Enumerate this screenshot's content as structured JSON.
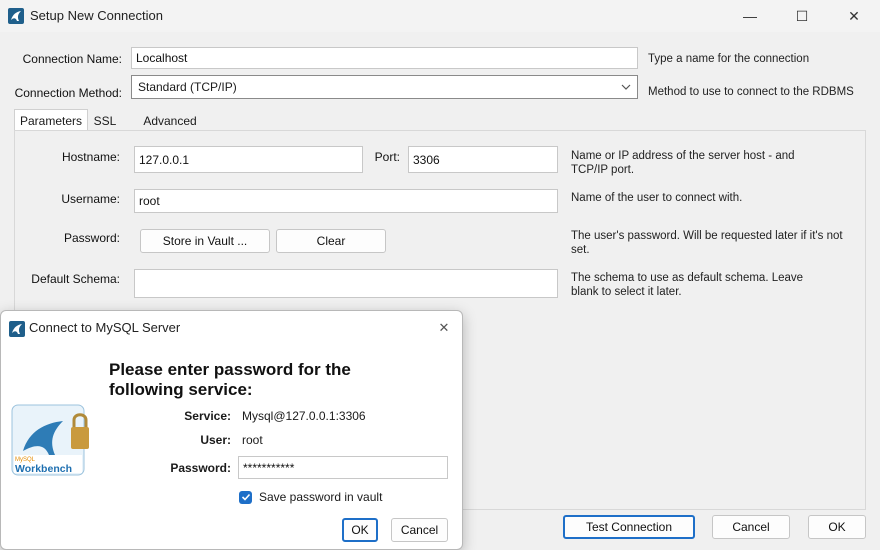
{
  "window": {
    "title": "Setup New Connection",
    "minimize_glyph": "—",
    "maximize_glyph": "☐",
    "close_glyph": "✕"
  },
  "form": {
    "connection_name_label": "Connection Name:",
    "connection_name_value": "Localhost",
    "connection_name_hint": "Type a name for the connection",
    "connection_method_label": "Connection Method:",
    "connection_method_value": "Standard (TCP/IP)",
    "connection_method_hint": "Method to use to connect to the RDBMS"
  },
  "tabs": [
    {
      "label": "Parameters",
      "active": true
    },
    {
      "label": "SSL",
      "active": false
    },
    {
      "label": "Advanced",
      "active": false
    }
  ],
  "parameters": {
    "hostname_label": "Hostname:",
    "hostname_value": "127.0.0.1",
    "port_label": "Port:",
    "port_value": "3306",
    "hostname_hint": "Name or IP address of the server host - and TCP/IP port.",
    "username_label": "Username:",
    "username_value": "root",
    "username_hint": "Name of the user to connect with.",
    "password_label": "Password:",
    "store_in_vault": "Store in Vault ...",
    "clear": "Clear",
    "password_hint": "The user's password. Will be requested later if it's not set.",
    "default_schema_label": "Default Schema:",
    "default_schema_value": "",
    "default_schema_hint": "The schema to use as default schema. Leave blank to select it later."
  },
  "footer": {
    "test_connection": "Test Connection",
    "cancel": "Cancel",
    "ok": "OK"
  },
  "dialog": {
    "title": "Connect to MySQL Server",
    "close_glyph": "✕",
    "heading": "Please enter password for the following service:",
    "service_label": "Service:",
    "service_value": "Mysql@127.0.0.1:3306",
    "user_label": "User:",
    "user_value": "root",
    "password_label": "Password:",
    "password_value": "***********",
    "save_password_label": "Save password in vault",
    "save_password_checked": true,
    "ok": "OK",
    "cancel": "Cancel",
    "logo_text": "Workbench",
    "logo_brand": "MySQL"
  },
  "colors": {
    "accent": "#1e6fc8",
    "brand": "#1f5f8b"
  }
}
